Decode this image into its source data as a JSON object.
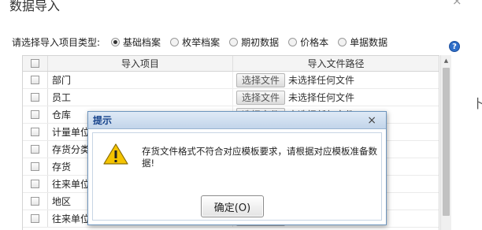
{
  "dialog": {
    "title": "数据导入",
    "close_glyph": "×",
    "right_edge_text": "卜"
  },
  "import_type": {
    "label": "请选择导入项目类型:",
    "options": [
      {
        "label": "基础档案",
        "selected": true
      },
      {
        "label": "枚举档案",
        "selected": false
      },
      {
        "label": "期初数据",
        "selected": false
      },
      {
        "label": "价格本",
        "selected": false
      },
      {
        "label": "单据数据",
        "selected": false
      }
    ],
    "help_glyph": "?"
  },
  "grid": {
    "headers": {
      "item": "导入项目",
      "path": "导入文件路径"
    },
    "file_button_label": "选择文件",
    "file_status": "未选择任何文件",
    "rows": [
      {
        "name": "部门"
      },
      {
        "name": "员工"
      },
      {
        "name": "仓库"
      },
      {
        "name": "计量单位"
      },
      {
        "name": "存货分类"
      },
      {
        "name": "存货"
      },
      {
        "name": "往来单位"
      },
      {
        "name": "地区"
      },
      {
        "name": "往来单位"
      }
    ]
  },
  "modal": {
    "title": "提示",
    "close_glyph": "×",
    "icon": "warning-icon",
    "message": "存货文件格式不符合对应模板要求，请根据对应模板准备数据!",
    "ok_label": "确定(O)"
  },
  "colors": {
    "modal_border": "#6e95bd",
    "modal_title": "#15428b",
    "warning_yellow": "#f5c400",
    "help_blue": "#2f6fc9"
  }
}
